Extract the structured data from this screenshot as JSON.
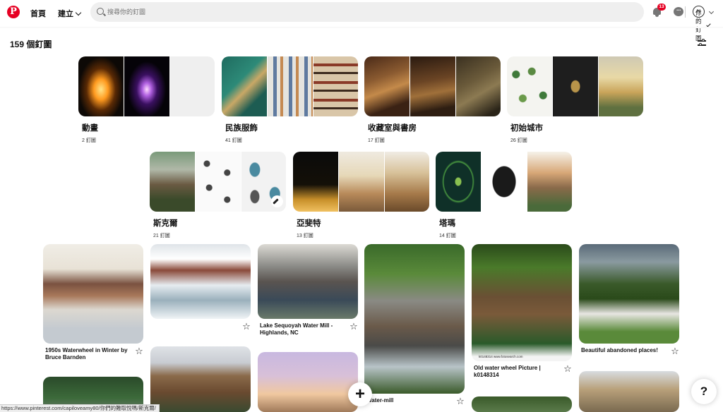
{
  "nav": {
    "home_label": "首頁",
    "create_label": "建立",
    "search_placeholder": "搜尋你的釘圖",
    "search_scope": "你的釘圖",
    "notifications_badge": "13",
    "avatar_letter": "H"
  },
  "profile": {
    "pin_count": "159 個釘圖"
  },
  "boards": [
    {
      "title": "動畫",
      "count": "2 釘圖"
    },
    {
      "title": "民族服飾",
      "count": "41 釘圖"
    },
    {
      "title": "收藏室與書房",
      "count": "17 釘圖"
    },
    {
      "title": "初始城市",
      "count": "26 釘圖"
    },
    {
      "title": "斯克爾",
      "count": "21 釘圖"
    },
    {
      "title": "亞斐特",
      "count": "13 釘圖"
    },
    {
      "title": "塔瑪",
      "count": "14 釘圖"
    }
  ],
  "pins": [
    {
      "caption": "1950s Waterwheel in Winter by Bruce Barnden"
    },
    {
      "caption": ""
    },
    {
      "caption": "Lake Sequoyah Water Mill - Highlands, NC"
    },
    {
      "caption": "Water-mill"
    },
    {
      "caption": "Old water wheel Picture | k0148314"
    },
    {
      "caption": "Beautiful abandoned places!"
    }
  ],
  "image_texts": {
    "fotosearch": "k0148314   www.fotosearch.com"
  },
  "fab": {
    "plus": "+",
    "help": "?"
  },
  "status_bar": {
    "url": "https://www.pinterest.com/capiloveamy80/你們的難取悅嗎/斯克爾/"
  },
  "colors": {
    "brand": "#e60023",
    "search_bg": "#efefef"
  }
}
